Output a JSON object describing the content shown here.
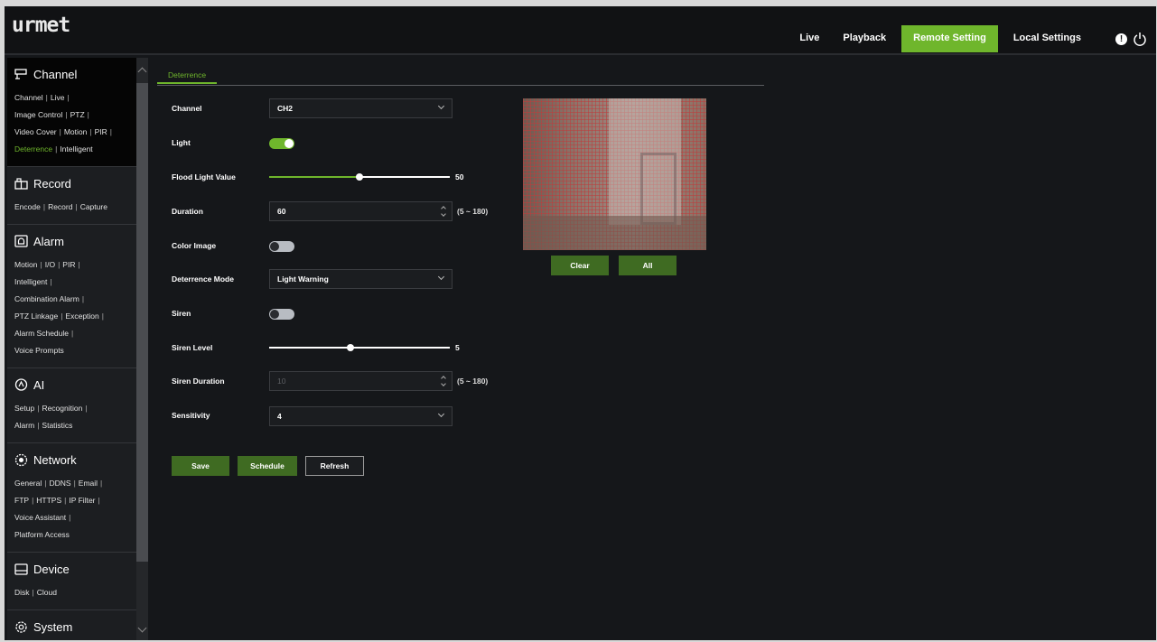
{
  "app": {
    "logo": "urmet"
  },
  "nav": {
    "live": "Live",
    "playback": "Playback",
    "remote_setting": "Remote Setting",
    "local_settings": "Local Settings"
  },
  "sidebar": {
    "channel": {
      "title": "Channel",
      "links": [
        "Channel",
        "Live",
        "Image Control",
        "PTZ",
        "Video Cover",
        "Motion",
        "PIR",
        "Deterrence",
        "Intelligent"
      ]
    },
    "record": {
      "title": "Record",
      "links": [
        "Encode",
        "Record",
        "Capture"
      ]
    },
    "alarm": {
      "title": "Alarm",
      "links": [
        "Motion",
        "I/O",
        "PIR",
        "Intelligent",
        "Combination Alarm",
        "PTZ Linkage",
        "Exception",
        "Alarm Schedule",
        "Voice Prompts"
      ]
    },
    "ai": {
      "title": "AI",
      "links": [
        "Setup",
        "Recognition",
        "Alarm",
        "Statistics"
      ]
    },
    "network": {
      "title": "Network",
      "links": [
        "General",
        "DDNS",
        "Email",
        "FTP",
        "HTTPS",
        "IP Filter",
        "Voice Assistant",
        "Platform Access"
      ]
    },
    "device": {
      "title": "Device",
      "links": [
        "Disk",
        "Cloud"
      ]
    },
    "system": {
      "title": "System"
    }
  },
  "tab": {
    "label": "Deterrence"
  },
  "form": {
    "channel": {
      "label": "Channel",
      "value": "CH2"
    },
    "light": {
      "label": "Light",
      "on": true
    },
    "flood_light": {
      "label": "Flood Light Value",
      "value": "50",
      "fraction": 0.5
    },
    "duration": {
      "label": "Duration",
      "value": "60",
      "range": "(5 ~ 180)"
    },
    "color_image": {
      "label": "Color Image",
      "on": false
    },
    "deterrence_mode": {
      "label": "Deterrence Mode",
      "value": "Light Warning"
    },
    "siren": {
      "label": "Siren",
      "on": false
    },
    "siren_level": {
      "label": "Siren Level",
      "value": "5",
      "fraction": 0.45
    },
    "siren_duration": {
      "label": "Siren Duration",
      "value": "10",
      "range": "(5 ~ 180)"
    },
    "sensitivity": {
      "label": "Sensitivity",
      "value": "4"
    }
  },
  "buttons": {
    "save": "Save",
    "schedule": "Schedule",
    "refresh": "Refresh",
    "clear": "Clear",
    "all": "All"
  },
  "colors": {
    "accent": "#6fb62c",
    "button": "#3f6b22",
    "background": "#15171a"
  }
}
